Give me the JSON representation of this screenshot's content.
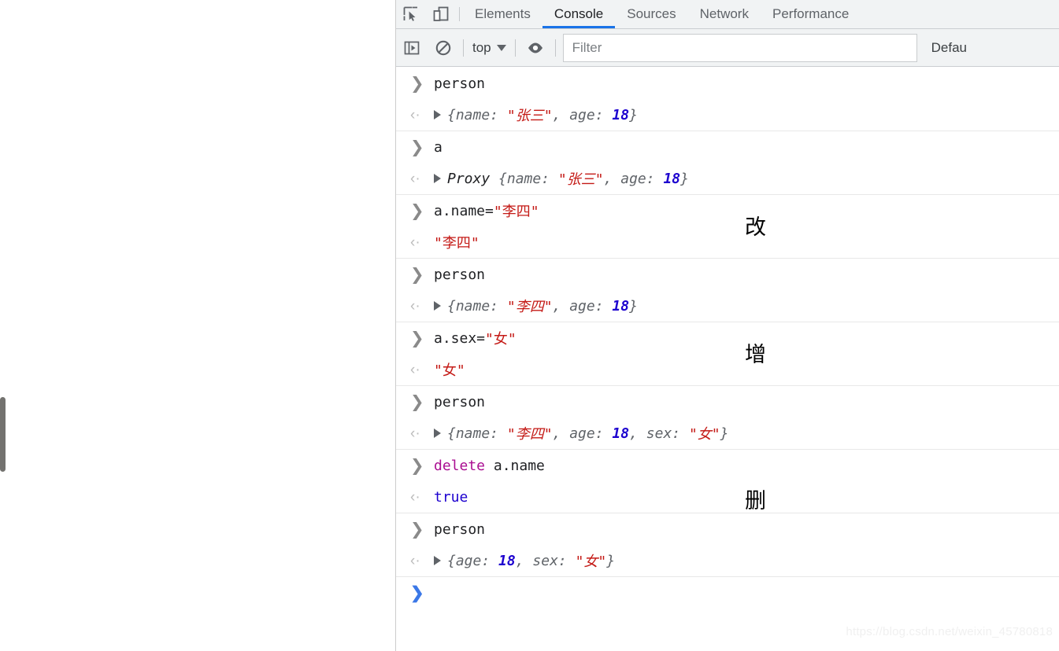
{
  "devtools": {
    "tabs": [
      {
        "label": "Elements",
        "active": false
      },
      {
        "label": "Console",
        "active": true
      },
      {
        "label": "Sources",
        "active": false
      },
      {
        "label": "Network",
        "active": false
      },
      {
        "label": "Performance",
        "active": false
      }
    ],
    "toolbar_icons": [
      "inspect-element-icon",
      "device-toolbar-icon"
    ],
    "filterbar": {
      "sidebar_toggle_icon": "console-sidebar-icon",
      "clear_icon": "clear-console-icon",
      "context": "top",
      "eye_icon": "live-expression-icon",
      "filter_placeholder": "Filter",
      "filter_value": "",
      "levels_label": "Defau"
    },
    "active_tab_underline_color": "#1a73e8",
    "prompt_chevron_color": "#3b78e7"
  },
  "console": {
    "input_marker": "❯",
    "output_marker": "‹·",
    "prompt_marker": "❯",
    "groups": [
      {
        "input": {
          "text": "person"
        },
        "output": {
          "parts": [
            {
              "t": "{name: ",
              "c": "obj"
            },
            {
              "t": "\"张三\"",
              "c": "str"
            },
            {
              "t": ", age: ",
              "c": "obj"
            },
            {
              "t": "18",
              "c": "num"
            },
            {
              "t": "}",
              "c": "obj"
            }
          ]
        }
      },
      {
        "input": {
          "text": "a"
        },
        "output": {
          "parts": [
            {
              "t": "Proxy ",
              "c": "proxy"
            },
            {
              "t": "{name: ",
              "c": "obj"
            },
            {
              "t": "\"张三\"",
              "c": "str"
            },
            {
              "t": ", age: ",
              "c": "obj"
            },
            {
              "t": "18",
              "c": "num"
            },
            {
              "t": "}",
              "c": "obj"
            }
          ]
        }
      },
      {
        "input": {
          "parts": [
            {
              "t": "a.name=",
              "c": "plain"
            },
            {
              "t": "\"李四\"",
              "c": "str-plain"
            }
          ]
        },
        "output": {
          "noTriangle": true,
          "parts": [
            {
              "t": "\"李四\"",
              "c": "str-plain"
            }
          ]
        },
        "annotation": "改"
      },
      {
        "input": {
          "text": "person"
        },
        "output": {
          "parts": [
            {
              "t": "{name: ",
              "c": "obj"
            },
            {
              "t": "\"李四\"",
              "c": "str"
            },
            {
              "t": ", age: ",
              "c": "obj"
            },
            {
              "t": "18",
              "c": "num"
            },
            {
              "t": "}",
              "c": "obj"
            }
          ]
        }
      },
      {
        "input": {
          "parts": [
            {
              "t": "a.sex=",
              "c": "plain"
            },
            {
              "t": "\"女\"",
              "c": "str-plain"
            }
          ]
        },
        "output": {
          "noTriangle": true,
          "parts": [
            {
              "t": "\"女\"",
              "c": "str-plain"
            }
          ]
        },
        "annotation": "增"
      },
      {
        "input": {
          "text": "person"
        },
        "output": {
          "parts": [
            {
              "t": "{name: ",
              "c": "obj"
            },
            {
              "t": "\"李四\"",
              "c": "str"
            },
            {
              "t": ", age: ",
              "c": "obj"
            },
            {
              "t": "18",
              "c": "num"
            },
            {
              "t": ", sex: ",
              "c": "obj"
            },
            {
              "t": "\"女\"",
              "c": "str"
            },
            {
              "t": "}",
              "c": "obj"
            }
          ]
        }
      },
      {
        "input": {
          "parts": [
            {
              "t": "delete",
              "c": "kw"
            },
            {
              "t": " a.name",
              "c": "plain"
            }
          ]
        },
        "output": {
          "noTriangle": true,
          "parts": [
            {
              "t": "true",
              "c": "bool"
            }
          ]
        },
        "annotation": "删"
      },
      {
        "input": {
          "text": "person"
        },
        "output": {
          "parts": [
            {
              "t": "{age: ",
              "c": "obj"
            },
            {
              "t": "18",
              "c": "num"
            },
            {
              "t": ", sex: ",
              "c": "obj"
            },
            {
              "t": "\"女\"",
              "c": "str"
            },
            {
              "t": "}",
              "c": "obj"
            }
          ]
        }
      }
    ]
  },
  "watermark": "https://blog.csdn.net/weixin_45780818"
}
